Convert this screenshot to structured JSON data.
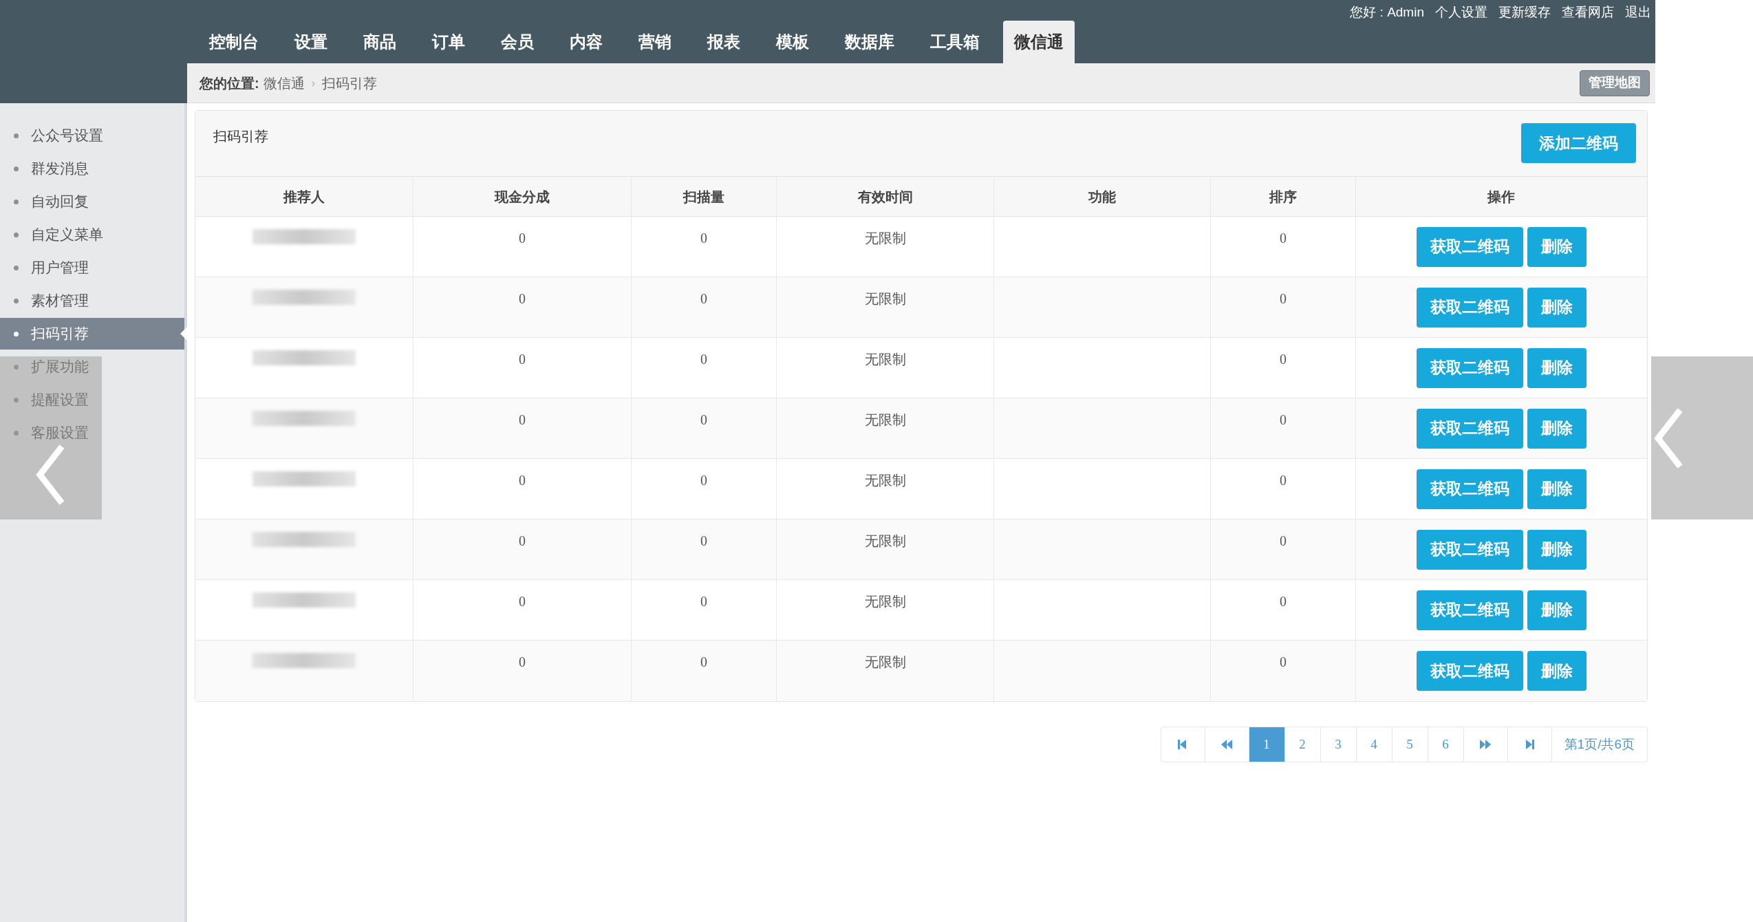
{
  "top_links": [
    "您好 : Admin",
    "个人设置",
    "更新缓存",
    "查看网店",
    "退出"
  ],
  "nav": [
    {
      "label": "控制台",
      "selected": false
    },
    {
      "label": "设置",
      "selected": false
    },
    {
      "label": "商品",
      "selected": false
    },
    {
      "label": "订单",
      "selected": false
    },
    {
      "label": "会员",
      "selected": false
    },
    {
      "label": "内容",
      "selected": false
    },
    {
      "label": "营销",
      "selected": false
    },
    {
      "label": "报表",
      "selected": false
    },
    {
      "label": "模板",
      "selected": false
    },
    {
      "label": "数据库",
      "selected": false
    },
    {
      "label": "工具箱",
      "selected": false
    },
    {
      "label": "微信通",
      "selected": true
    }
  ],
  "breadcrumb": {
    "label": "您的位置:",
    "items": [
      "微信通",
      "扫码引荐"
    ],
    "separator": "›",
    "button": "管理地图"
  },
  "sidebar": {
    "items": [
      {
        "label": "公众号设置",
        "selected": false
      },
      {
        "label": "群发消息",
        "selected": false
      },
      {
        "label": "自动回复",
        "selected": false
      },
      {
        "label": "自定义菜单",
        "selected": false
      },
      {
        "label": "用户管理",
        "selected": false
      },
      {
        "label": "素材管理",
        "selected": false
      },
      {
        "label": "扫码引荐",
        "selected": true
      },
      {
        "label": "扩展功能",
        "selected": false
      },
      {
        "label": "提醒设置",
        "selected": false
      },
      {
        "label": "客服设置",
        "selected": false
      }
    ]
  },
  "panel": {
    "title": "扫码引荐",
    "add_button": "添加二维码"
  },
  "table": {
    "columns": [
      "推荐人",
      "现金分成",
      "扫描量",
      "有效时间",
      "功能",
      "排序",
      "操作"
    ],
    "rows": [
      {
        "share": "0",
        "scans": "0",
        "validity": "无限制",
        "sort": "0",
        "actions": [
          "获取二维码",
          "删除"
        ]
      },
      {
        "share": "0",
        "scans": "0",
        "validity": "无限制",
        "sort": "0",
        "actions": [
          "获取二维码",
          "删除"
        ]
      },
      {
        "share": "0",
        "scans": "0",
        "validity": "无限制",
        "sort": "0",
        "actions": [
          "获取二维码",
          "删除"
        ]
      },
      {
        "share": "0",
        "scans": "0",
        "validity": "无限制",
        "sort": "0",
        "actions": [
          "获取二维码",
          "删除"
        ]
      },
      {
        "share": "0",
        "scans": "0",
        "validity": "无限制",
        "sort": "0",
        "actions": [
          "获取二维码",
          "删除"
        ]
      },
      {
        "share": "0",
        "scans": "0",
        "validity": "无限制",
        "sort": "0",
        "actions": [
          "获取二维码",
          "删除"
        ]
      },
      {
        "share": "0",
        "scans": "0",
        "validity": "无限制",
        "sort": "0",
        "actions": [
          "获取二维码",
          "删除"
        ]
      },
      {
        "share": "0",
        "scans": "0",
        "validity": "无限制",
        "sort": "0",
        "actions": [
          "获取二维码",
          "删除"
        ]
      }
    ]
  },
  "pagination": {
    "pages": [
      {
        "label": "1",
        "selected": true
      },
      {
        "label": "2",
        "selected": false
      },
      {
        "label": "3",
        "selected": false
      },
      {
        "label": "4",
        "selected": false
      },
      {
        "label": "5",
        "selected": false
      },
      {
        "label": "6",
        "selected": false
      }
    ],
    "info": "第1页/共6页"
  }
}
